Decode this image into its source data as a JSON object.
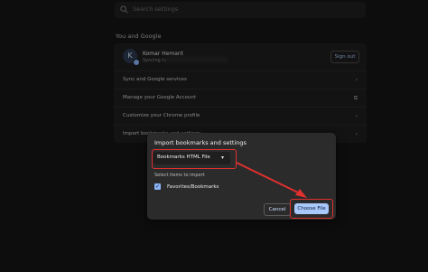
{
  "search": {
    "placeholder": "Search settings",
    "icon": "search-icon"
  },
  "section": {
    "title": "You and Google"
  },
  "profile": {
    "initial": "K",
    "name": "Komar Hemant",
    "status": "Syncing to",
    "sign_out_label": "Sign out"
  },
  "settings_rows": [
    {
      "label": "Sync and Google services",
      "icon": "chevron-right-icon"
    },
    {
      "label": "Manage your Google Account",
      "icon": "external-link-icon"
    },
    {
      "label": "Customize your Chrome profile",
      "icon": "chevron-right-icon"
    },
    {
      "label": "Import bookmarks and settings",
      "icon": "chevron-right-icon"
    }
  ],
  "dialog": {
    "title": "Import bookmarks and settings",
    "source_value": "Bookmarks HTML File",
    "select_items_label": "Select items to import",
    "checkbox_label": "Favorites/Bookmarks",
    "checkbox_checked": true,
    "cancel_label": "Cancel",
    "choose_label": "Choose File"
  },
  "colors": {
    "highlight": "#e03030",
    "accent": "#a8c7fa",
    "background": "#141414"
  }
}
